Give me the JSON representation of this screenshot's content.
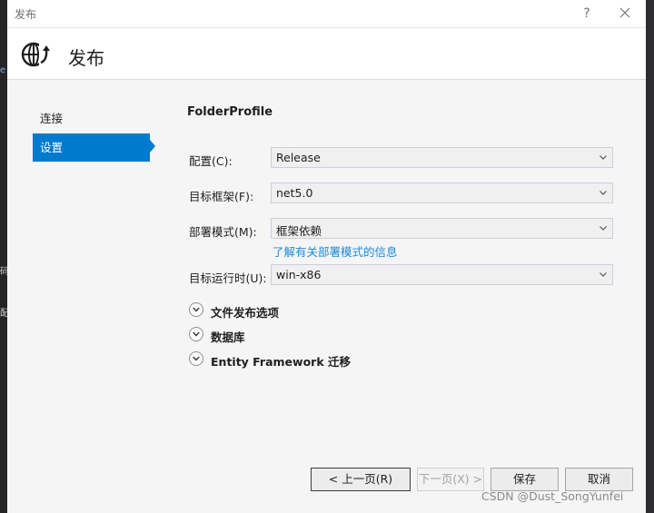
{
  "window": {
    "title": "发布",
    "help_label": "?"
  },
  "header": {
    "title": "发布",
    "icon": "globe-publish-icon"
  },
  "nav": {
    "items": [
      {
        "label": "连接",
        "active": false
      },
      {
        "label": "设置",
        "active": true
      }
    ]
  },
  "main": {
    "profile_name": "FolderProfile",
    "fields": [
      {
        "label": "配置(C):",
        "value": "Release"
      },
      {
        "label": "目标框架(F):",
        "value": "net5.0"
      },
      {
        "label": "部署模式(M):",
        "value": "框架依赖"
      },
      {
        "label": "目标运行时(U):",
        "value": "win-x86"
      }
    ],
    "deploy_mode_link": "了解有关部署模式的信息",
    "expanders": [
      {
        "label": "文件发布选项"
      },
      {
        "label": "数据库"
      },
      {
        "label": "Entity Framework 迁移"
      }
    ]
  },
  "footer": {
    "prev_label": "< 上一页(R)",
    "next_label": "下一页(X) >",
    "save_label": "保存",
    "cancel_label": "取消"
  },
  "watermark": "CSDN @Dust_SongYunfei",
  "ide_fragments": [
    "e",
    "码",
    "配"
  ],
  "colors": {
    "accent": "#007acc",
    "link": "#1a8ad4"
  }
}
